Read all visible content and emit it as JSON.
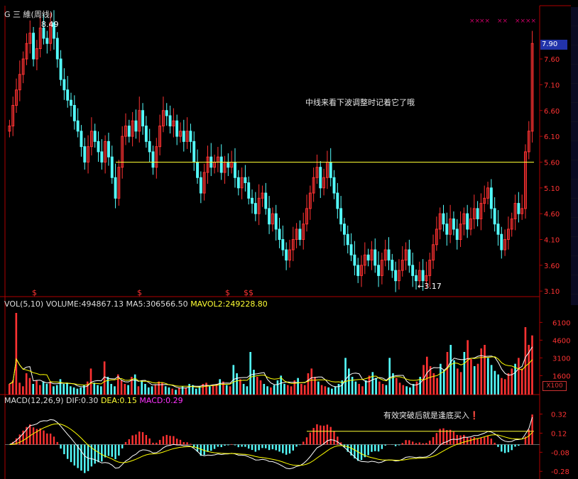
{
  "title": {
    "stock": "G 三 維",
    "period": "(周线)"
  },
  "top_marker_color": "#cc0066",
  "annotations": {
    "main_note": "中线来看下波调整时记着它了哦",
    "macd_note": "有效突破后就是逢底买入",
    "high_label": "8.49",
    "low_label": "3.17",
    "current_price": "7.90"
  },
  "vol_header": {
    "name": "VOL(5,10)",
    "volume": "VOLUME:494867.13",
    "ma5": "MA5:306566.50",
    "mavol2": "MAVOL2:249228.80",
    "scale": "X100"
  },
  "macd_header": {
    "name": "MACD(12,26,9)",
    "dif": "DIF:0.30",
    "dea": "DEA:0.15",
    "macd": "MACD:0.29"
  },
  "signal_marks": [
    "$",
    "$",
    "$",
    "$$"
  ],
  "colors": {
    "up": "#ff3232",
    "down": "#54ffff",
    "axis": "#b00000",
    "support_line": "#ffff33",
    "ma_white": "#ffffff",
    "ma_yellow": "#ffff00",
    "macd_label": "#ff33ff"
  },
  "chart_data": [
    {
      "type": "candlestick",
      "title": "G 三 維(周线)",
      "y_ticks": [
        "7.60",
        "7.10",
        "6.60",
        "6.10",
        "5.60",
        "5.10",
        "4.60",
        "4.10",
        "3.60",
        "3.10"
      ],
      "ylim": [
        3.02,
        8.55
      ],
      "high": 8.49,
      "low": 3.17,
      "last": 7.9,
      "support_level": 5.6,
      "close_series": [
        6.3,
        6.7,
        7.0,
        7.3,
        7.6,
        7.9,
        8.1,
        7.6,
        7.8,
        8.2,
        8.0,
        7.9,
        8.3,
        8.0,
        7.6,
        7.2,
        7.0,
        6.8,
        6.7,
        6.4,
        6.2,
        5.9,
        5.6,
        5.9,
        6.2,
        6.0,
        5.8,
        5.6,
        6.0,
        5.7,
        5.3,
        4.9,
        5.5,
        6.1,
        6.3,
        6.1,
        6.4,
        6.2,
        6.6,
        6.3,
        6.0,
        5.8,
        5.5,
        5.9,
        6.3,
        6.6,
        6.5,
        6.3,
        6.4,
        6.1,
        6.2,
        6.0,
        6.2,
        6.0,
        5.6,
        5.3,
        5.0,
        5.4,
        5.7,
        5.5,
        5.6,
        5.7,
        5.4,
        5.6,
        5.5,
        5.6,
        5.3,
        5.1,
        5.3,
        5.2,
        4.9,
        4.8,
        4.6,
        4.9,
        5.0,
        4.7,
        4.4,
        4.6,
        4.3,
        4.1,
        3.9,
        3.7,
        3.9,
        4.1,
        4.3,
        4.1,
        4.4,
        4.7,
        5.0,
        5.3,
        5.5,
        5.1,
        5.3,
        5.6,
        5.3,
        5.0,
        4.7,
        4.4,
        4.2,
        4.0,
        3.8,
        3.6,
        3.4,
        3.6,
        3.8,
        3.7,
        3.9,
        3.6,
        3.4,
        3.7,
        3.9,
        3.7,
        3.5,
        3.3,
        3.5,
        3.7,
        3.9,
        3.6,
        3.4,
        3.3,
        3.5,
        3.3,
        3.4,
        3.7,
        4.0,
        4.3,
        4.6,
        4.4,
        4.2,
        4.5,
        4.3,
        4.1,
        4.4,
        4.6,
        4.3,
        4.5,
        4.7,
        4.5,
        4.8,
        4.9,
        5.1,
        4.7,
        4.4,
        4.2,
        3.9,
        4.1,
        4.3,
        4.5,
        4.8,
        4.6,
        4.7,
        5.8,
        6.2,
        7.9
      ]
    },
    {
      "type": "bar",
      "title": "VOL(5,10)",
      "y_ticks": [
        "6100",
        "4600",
        "3100",
        "1600"
      ],
      "ylim": [
        0,
        7200
      ],
      "unit": "X100",
      "last_volume": 494867.13,
      "ma5": 306566.5,
      "ma10": 249228.8,
      "values": [
        900,
        1200,
        6900,
        1000,
        700,
        1800,
        1400,
        900,
        1200,
        800,
        1100,
        900,
        1100,
        700,
        800,
        1300,
        900,
        1000,
        700,
        600,
        500,
        600,
        800,
        1100,
        2200,
        1000,
        800,
        700,
        2800,
        1500,
        900,
        700,
        1700,
        1200,
        900,
        800,
        1500,
        1700,
        700,
        1200,
        900,
        600,
        700,
        800,
        1100,
        1000,
        700,
        600,
        500,
        400,
        600,
        700,
        600,
        900,
        800,
        500,
        700,
        900,
        1000,
        700,
        800,
        900,
        1300,
        1100,
        800,
        700,
        2500,
        1800,
        1300,
        900,
        700,
        3600,
        2100,
        1500,
        1200,
        900,
        700,
        600,
        800,
        1200,
        1600,
        900,
        800,
        700,
        1200,
        1400,
        900,
        800,
        1800,
        2200,
        1500,
        1100,
        800,
        700,
        600,
        500,
        700,
        900,
        1200,
        3100,
        2200,
        1500,
        1100,
        900,
        700,
        1200,
        1600,
        1900,
        1400,
        1100,
        900,
        800,
        3100,
        1800,
        1400,
        1000,
        800,
        700,
        600,
        900,
        1100,
        1500,
        2500,
        3200,
        2400,
        1800,
        1400,
        2600,
        2100,
        3600,
        4200,
        2900,
        2200,
        1900,
        3600,
        4600,
        3000,
        2400,
        2600,
        3900,
        4200,
        3100,
        2500,
        2000,
        1700,
        1400,
        1300,
        1800,
        2200,
        2600,
        3100,
        2200,
        5700,
        4200,
        5000
      ]
    },
    {
      "type": "bar",
      "title": "MACD(12,26,9)",
      "y_ticks": [
        "0.32",
        "0.12",
        "-0.08",
        "-0.28"
      ],
      "ylim": [
        -0.36,
        0.42
      ],
      "dif": 0.3,
      "dea": 0.15,
      "macd": 0.29,
      "breakout_level": 0.14
    }
  ]
}
